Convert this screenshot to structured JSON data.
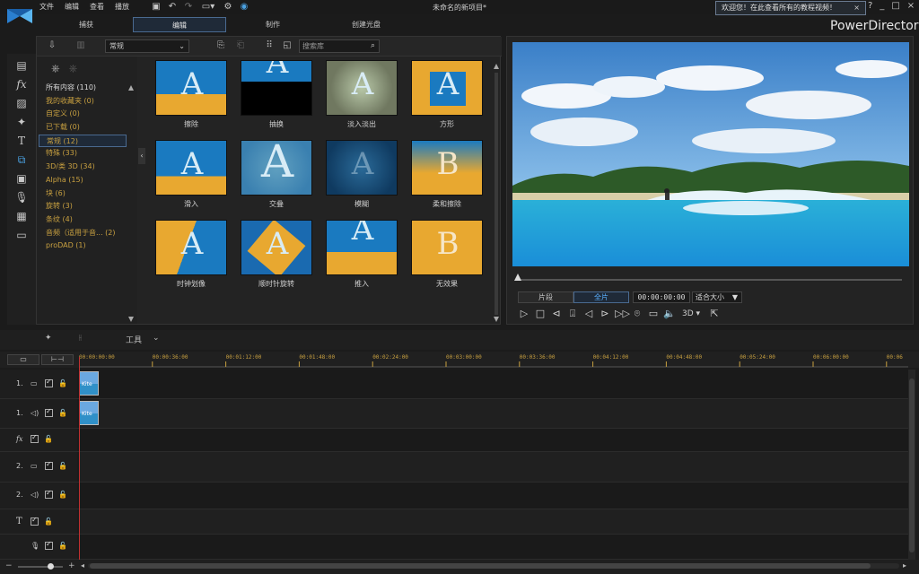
{
  "titlebar": {
    "menus": [
      "文件",
      "编辑",
      "查看",
      "播放"
    ],
    "project_name": "未命名的新项目*",
    "welcome_text": "欢迎您！在此查看所有的教程视频！",
    "welcome_close": "×",
    "help": "?",
    "min": "_",
    "max": "□",
    "close": "×",
    "brand": "PowerDirector",
    "brand_color": "#e6e6e6",
    "accent_color": "#4aa0e0"
  },
  "modetabs": [
    "捕获",
    "编辑",
    "制作",
    "创建光盘"
  ],
  "library": {
    "select_value": "常规",
    "search_placeholder": "搜索库",
    "categories": [
      {
        "label": "所有内容 (110)",
        "style": "white"
      },
      {
        "label": "我的收藏夹  (0)",
        "style": "gold"
      },
      {
        "label": "自定义  (0)",
        "style": "gold"
      },
      {
        "label": "已下载  (0)",
        "style": "gold"
      },
      {
        "label": "常规  (12)",
        "style": "sel"
      },
      {
        "label": "特殊  (33)",
        "style": "gold"
      },
      {
        "label": "3D/类 3D  (34)",
        "style": "gold"
      },
      {
        "label": "Alpha  (15)",
        "style": "gold"
      },
      {
        "label": "块  (6)",
        "style": "gold"
      },
      {
        "label": "旋转  (3)",
        "style": "gold"
      },
      {
        "label": "条纹  (4)",
        "style": "gold"
      },
      {
        "label": "音频（适用于音... (2)",
        "style": "gold"
      },
      {
        "label": "proDAD  (1)",
        "style": "gold"
      }
    ],
    "tiles": [
      {
        "label": "擦除",
        "letter": "A"
      },
      {
        "label": "抽换",
        "letter": "A"
      },
      {
        "label": "淡入淡出",
        "letter": "A"
      },
      {
        "label": "方形",
        "letter": "A"
      },
      {
        "label": "滑入",
        "letter": "A"
      },
      {
        "label": "交叠",
        "letter": "A"
      },
      {
        "label": "模糊",
        "letter": "A"
      },
      {
        "label": "柔和擦除",
        "letter": "B"
      },
      {
        "label": "时钟划像",
        "letter": "A"
      },
      {
        "label": "顺时针旋转",
        "letter": "A"
      },
      {
        "label": "推入",
        "letter": "A"
      },
      {
        "label": "无效果",
        "letter": "B"
      }
    ]
  },
  "preview": {
    "tab_clip": "片段",
    "tab_movie": "全片",
    "timecode": "00:00:00:00",
    "fit": "适合大小",
    "fit_chevron": "▼",
    "threeD": "3D ▾"
  },
  "timeline": {
    "tools_label": "工具",
    "ticks": [
      "00:00:00:00",
      "00:00:36:00",
      "00:01:12:00",
      "00:01:48:00",
      "00:02:24:00",
      "00:03:00:00",
      "00:03:36:00",
      "00:04:12:00",
      "00:04:48:00",
      "00:05:24:00",
      "00:06:00:00",
      "00:06"
    ],
    "tracks": [
      {
        "label": "1.",
        "icon": "video-track-icon"
      },
      {
        "label": "1.",
        "icon": "audio-track-icon"
      },
      {
        "label": "fx",
        "icon": "fx-track-icon"
      },
      {
        "label": "2.",
        "icon": "video-track-icon"
      },
      {
        "label": "2.",
        "icon": "audio-track-icon"
      },
      {
        "label": "T",
        "icon": "title-track-icon"
      },
      {
        "label": "",
        "icon": "voice-track-icon"
      }
    ],
    "clip_label": "Kite"
  }
}
